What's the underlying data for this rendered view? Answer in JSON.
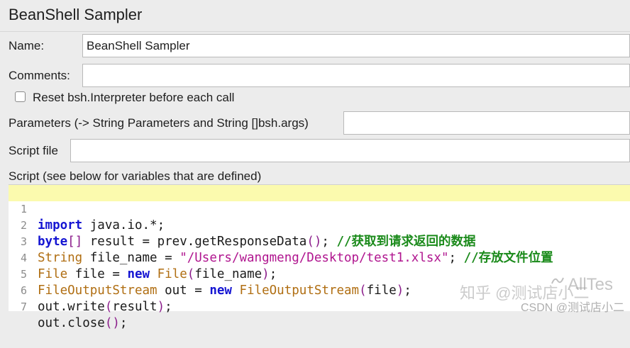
{
  "panel": {
    "title": "BeanShell Sampler",
    "name_label": "Name:",
    "name_value": "BeanShell Sampler",
    "comments_label": "Comments:",
    "comments_value": "",
    "reset_label": "Reset bsh.Interpreter before each call",
    "parameters_label": "Parameters (-> String Parameters and String []bsh.args)",
    "parameters_value": "",
    "script_file_label": "Script file",
    "script_file_value": "",
    "script_label": "Script (see below for variables that are defined)"
  },
  "editor": {
    "line_numbers": [
      "1",
      "2",
      "3",
      "4",
      "5",
      "6",
      "7"
    ],
    "lines": [
      [
        "import",
        " java.io.*;"
      ],
      [
        "byte",
        "[]",
        " result = prev.getResponseData",
        "()",
        "; ",
        "//获取到请求返回的数据"
      ],
      [
        "String",
        " file_name = ",
        "\"/Users/wangmeng/Desktop/test1.xlsx\"",
        "; ",
        "//存放文件位置"
      ],
      [
        "File",
        " file = ",
        "new",
        " ",
        "File",
        "(",
        "file_name",
        ")",
        ";"
      ],
      [
        "FileOutputStream",
        " out = ",
        "new",
        " ",
        "FileOutputStream",
        "(",
        "file",
        ")",
        ";"
      ],
      [
        "out.write",
        "(",
        "result",
        ")",
        ";"
      ],
      [
        "out.close",
        "()",
        ";"
      ]
    ]
  },
  "watermark": {
    "text1": "知乎 @测试店小二",
    "text2": "CSDN @测试店小二",
    "text3": "AllTes"
  }
}
